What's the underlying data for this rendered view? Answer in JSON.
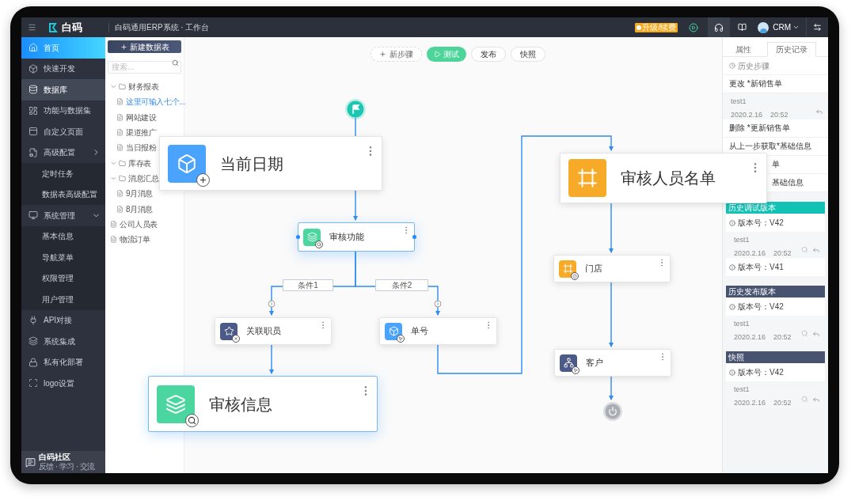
{
  "topbar": {
    "logo": "白码",
    "title": "白码通用ERP系统 · 工作台",
    "upgrade": "升级/续费",
    "user": "CRM"
  },
  "sidebar": {
    "items": [
      {
        "label": "首页",
        "kind": "item",
        "selected": true
      },
      {
        "label": "快速开发",
        "kind": "item",
        "selected": false
      },
      {
        "label": "数据库",
        "kind": "item",
        "selected": false,
        "highlighted": true
      },
      {
        "label": "功能与数据集",
        "kind": "item",
        "selected": false
      },
      {
        "label": "自定义页面",
        "kind": "item",
        "selected": false
      },
      {
        "label": "高级配置",
        "kind": "group",
        "expanded": false,
        "selected": false
      },
      {
        "label": "定时任务",
        "kind": "sub",
        "selected": false
      },
      {
        "label": "数据表高级配置",
        "kind": "sub",
        "selected": false
      },
      {
        "label": "系统管理",
        "kind": "group",
        "expanded": true,
        "selected": false
      },
      {
        "label": "基本信息",
        "kind": "sub",
        "selected": false
      },
      {
        "label": "导航菜单",
        "kind": "sub",
        "selected": false
      },
      {
        "label": "权限管理",
        "kind": "sub",
        "selected": false
      },
      {
        "label": "用户管理",
        "kind": "sub",
        "selected": false
      },
      {
        "label": "API对接",
        "kind": "item",
        "selected": false
      },
      {
        "label": "系统集成",
        "kind": "item",
        "selected": false
      },
      {
        "label": "私有化部署",
        "kind": "item",
        "selected": false
      },
      {
        "label": "logo设置",
        "kind": "item",
        "selected": false
      }
    ],
    "community": {
      "title": "白码社区",
      "subtitle": "反馈 · 学习 · 交流"
    }
  },
  "tree": {
    "button": "新建数据表",
    "search_placeholder": "搜索...",
    "items": [
      {
        "label": "财务报表",
        "kind": "folder",
        "expanded": true,
        "selected": false,
        "children": [
          {
            "label": "这里可输入七个...",
            "kind": "file",
            "selected": true
          },
          {
            "label": "网站建设",
            "kind": "file",
            "selected": false
          },
          {
            "label": "渠道推广",
            "kind": "file",
            "selected": false
          },
          {
            "label": "当日报粉",
            "kind": "file",
            "selected": false
          }
        ]
      },
      {
        "label": "库存表",
        "kind": "folder",
        "expanded": true,
        "selected": false
      },
      {
        "label": "消息汇总",
        "kind": "folder",
        "expanded": true,
        "selected": false,
        "children": [
          {
            "label": "9月消息",
            "kind": "file",
            "selected": false
          },
          {
            "label": "8月消息",
            "kind": "file",
            "selected": false
          }
        ]
      },
      {
        "label": "公司人员表",
        "kind": "file",
        "selected": false
      },
      {
        "label": "物流订单",
        "kind": "file",
        "selected": false
      }
    ]
  },
  "toolbar": [
    {
      "label": "新步骤",
      "kind": "add"
    },
    {
      "label": "测试",
      "kind": "primary"
    },
    {
      "label": "发布",
      "kind": "plain"
    },
    {
      "label": "快照",
      "kind": "plain"
    }
  ],
  "flow": {
    "conditions": [
      "条件1",
      "条件2"
    ],
    "nodes": [
      {
        "label": "当前日期",
        "kind": "large",
        "color": "#4aa3ff",
        "selected": false
      },
      {
        "label": "审核功能",
        "kind": "small",
        "color": "#4cd69f",
        "selected": true
      },
      {
        "label": "关联职员",
        "kind": "small",
        "color": "#4b5a86",
        "selected": false
      },
      {
        "label": "单号",
        "kind": "small",
        "color": "#4aa3ff",
        "selected": false
      },
      {
        "label": "审核信息",
        "kind": "large",
        "color": "#4cd69f",
        "selected": true
      },
      {
        "label": "审核人员名单",
        "kind": "large",
        "color": "#f7a928",
        "selected": false
      },
      {
        "label": "门店",
        "kind": "small",
        "color": "#f7a928",
        "selected": false
      },
      {
        "label": "客户",
        "kind": "small",
        "color": "#4b5a86",
        "selected": false
      }
    ]
  },
  "history": {
    "tabs": [
      {
        "label": "属性",
        "selected": false
      },
      {
        "label": "历史记录",
        "selected": true
      }
    ],
    "steps_title": "历史步骤",
    "steps": [
      {
        "kind": "action",
        "text": "更改 *新销售单"
      },
      {
        "kind": "detail",
        "user": "test1",
        "date": "2020.2.16",
        "time": "20:52"
      },
      {
        "kind": "action",
        "text": "删除 *更新销售单"
      },
      {
        "kind": "action",
        "text": "从上一步获取*基础信息"
      },
      {
        "kind": "cut",
        "text": "单"
      },
      {
        "kind": "cut",
        "text": "基础信息"
      }
    ],
    "sections": [
      {
        "title": "历史调试版本",
        "color": "#12c2b5",
        "entries": [
          {
            "kind": "version",
            "text": "版本号：V42"
          },
          {
            "kind": "detail",
            "user": "test1",
            "date": "2020.2.16",
            "time": "20:52",
            "searchable": true
          },
          {
            "kind": "version",
            "text": "版本号：V41"
          }
        ]
      },
      {
        "title": "历史发布版本",
        "color": "#47536f",
        "entries": [
          {
            "kind": "version",
            "text": "版本号：V42"
          },
          {
            "kind": "detail",
            "user": "test1",
            "date": "2020.2.16",
            "time": "20:52",
            "searchable": true
          }
        ]
      },
      {
        "title": "快照",
        "color": "#47536f",
        "entries": [
          {
            "kind": "version",
            "text": "版本号：V42"
          },
          {
            "kind": "detail",
            "user": "test1",
            "date": "2020.2.16",
            "time": "20:52",
            "searchable": true
          }
        ]
      }
    ]
  }
}
